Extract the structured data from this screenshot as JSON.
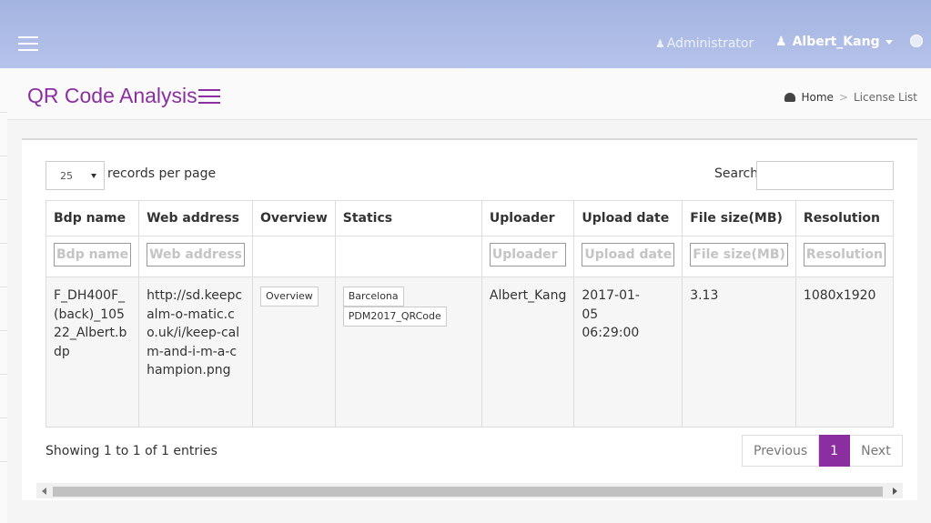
{
  "topbar": {
    "role": "Administrator",
    "user": "Albert_Kang"
  },
  "header": {
    "title": "QR Code Analysis",
    "breadcrumb": {
      "home": "Home",
      "current": "License List"
    }
  },
  "table_controls": {
    "page_length": "25",
    "page_length_label": "records per page",
    "search_label": "Search:",
    "search_value": ""
  },
  "table": {
    "columns": [
      "Bdp name",
      "Web address",
      "Overview",
      "Statics",
      "Uploader",
      "Upload date",
      "File size(MB)",
      "Resolution"
    ],
    "filters": [
      "Bdp name",
      "Web address",
      "",
      "",
      "Uploader",
      "Upload date",
      "File size(MB)",
      "Resolution"
    ],
    "rows": [
      {
        "bdp_name": "F_DH400F_(back)_10522_Albert.bdp",
        "web_address": "http://sd.keepcalm-o-matic.co.uk/i/keep-calm-and-i-m-a-champion.png",
        "overview": "Overview",
        "statics": [
          "Barcelona",
          "PDM2017_QRCode"
        ],
        "uploader": "Albert_Kang",
        "upload_date": "2017-01-05 06:29:00",
        "file_size": "3.13",
        "resolution": "1080x1920"
      }
    ]
  },
  "footer": {
    "info": "Showing 1 to 1 of 1 entries",
    "pagination": {
      "previous": "Previous",
      "page": "1",
      "next": "Next"
    }
  },
  "colors": {
    "accent": "#8b2fa0",
    "topbar": "#a3b4e0"
  }
}
